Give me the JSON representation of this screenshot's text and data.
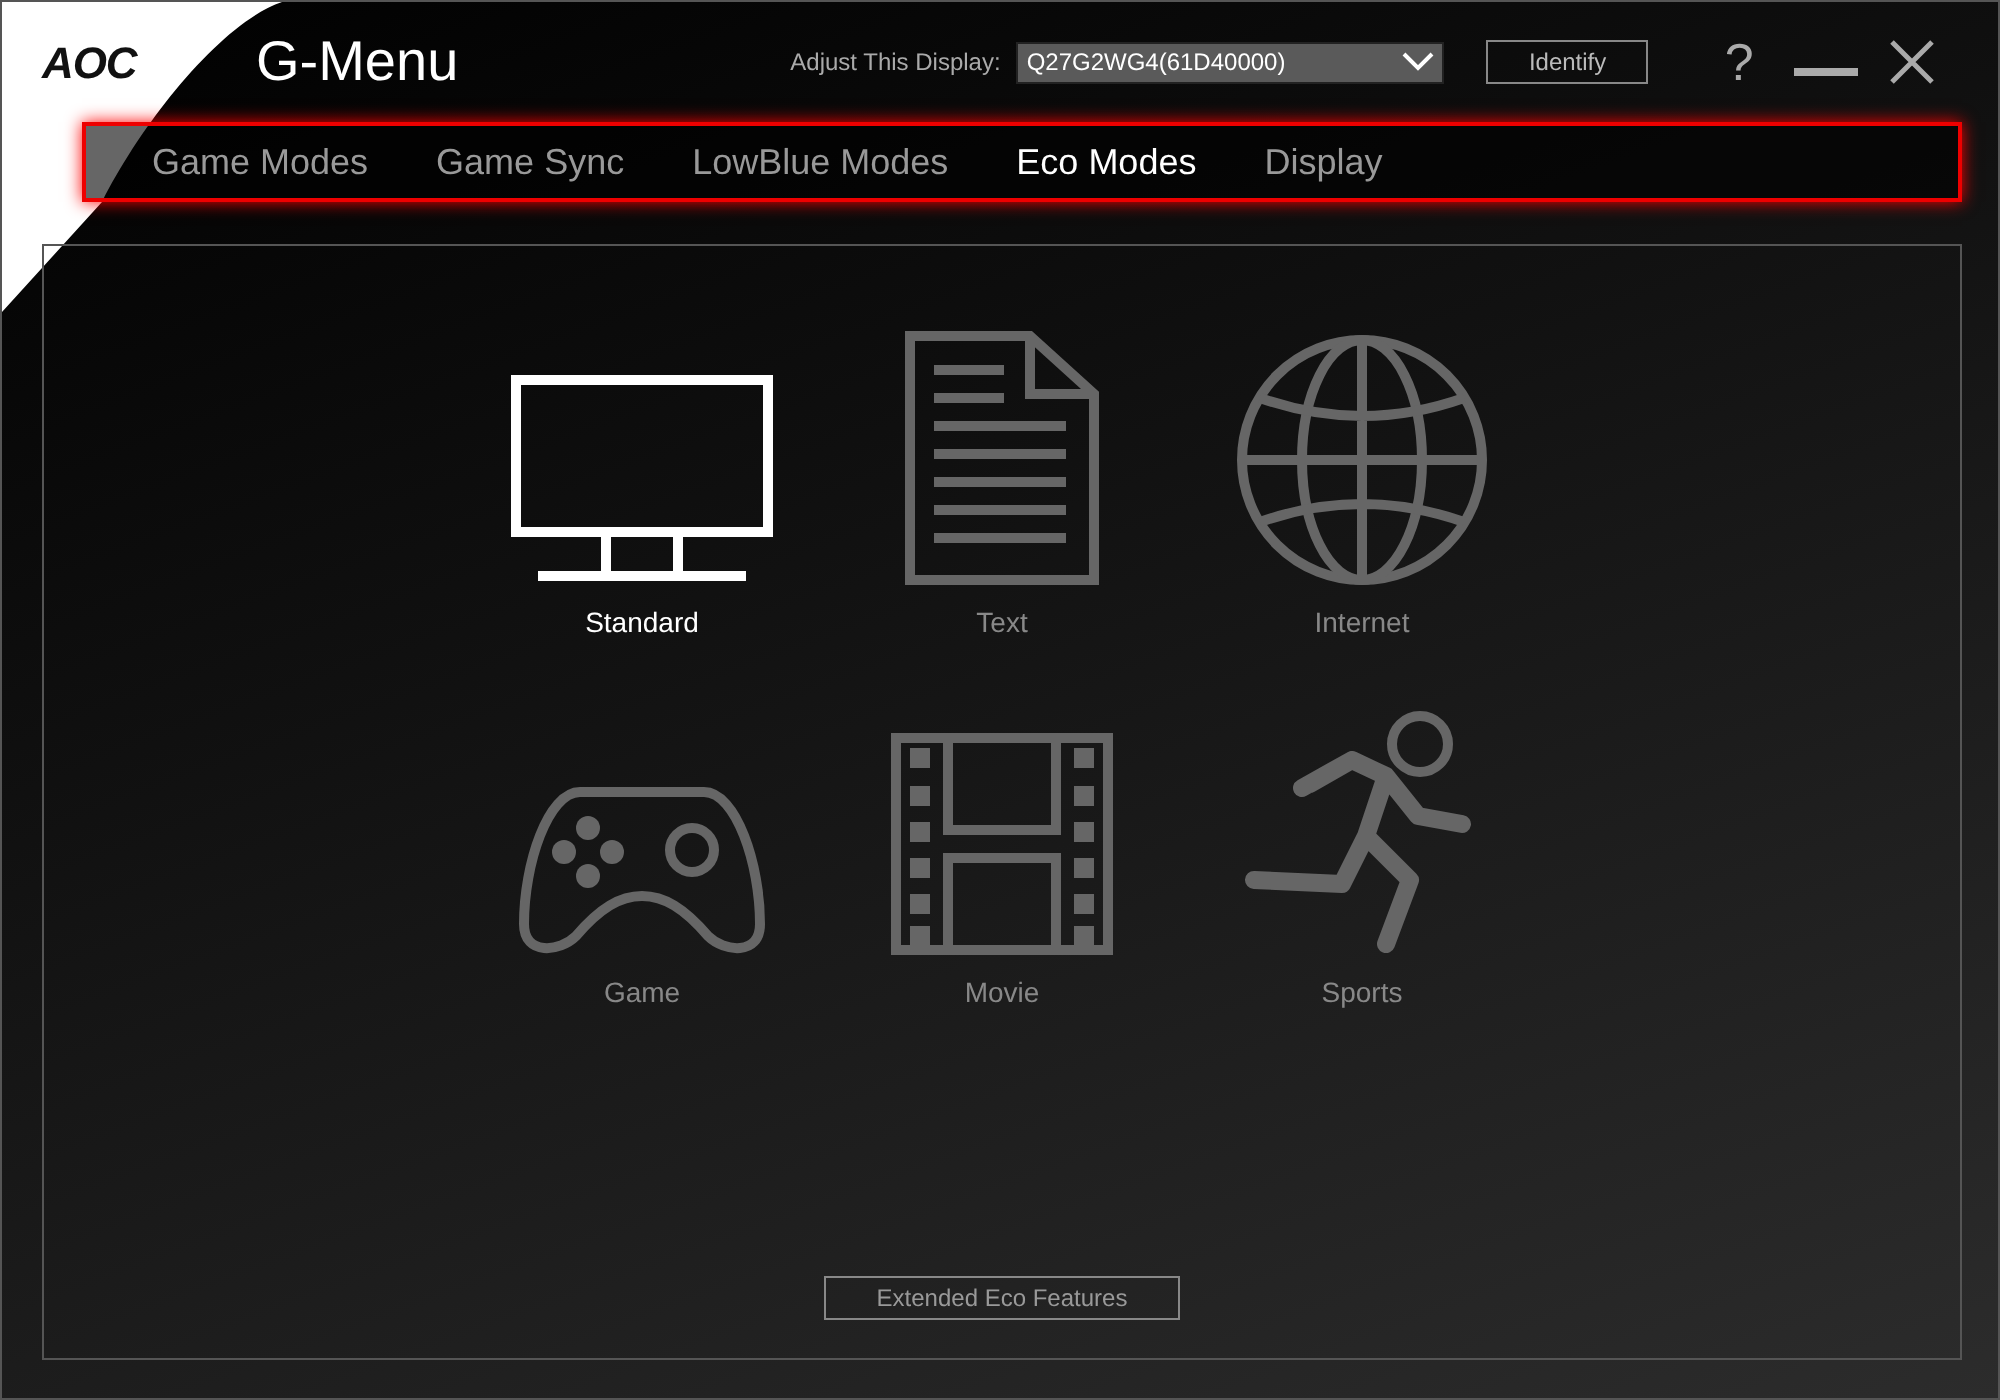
{
  "window": {
    "logo": "AOC",
    "title": "G-Menu"
  },
  "display_selector": {
    "label": "Adjust This Display:",
    "value": "Q27G2WG4(61D40000)"
  },
  "identify_button": "Identify",
  "help_button": "?",
  "tabs": [
    {
      "label": "Game Modes",
      "selected": false
    },
    {
      "label": "Game Sync",
      "selected": false
    },
    {
      "label": "LowBlue Modes",
      "selected": false
    },
    {
      "label": "Eco Modes",
      "selected": true
    },
    {
      "label": "Display",
      "selected": false
    }
  ],
  "modes": [
    {
      "kind": "standard",
      "label": "Standard",
      "selected": true
    },
    {
      "kind": "text",
      "label": "Text",
      "selected": false
    },
    {
      "kind": "internet",
      "label": "Internet",
      "selected": false
    },
    {
      "kind": "game",
      "label": "Game",
      "selected": false
    },
    {
      "kind": "movie",
      "label": "Movie",
      "selected": false
    },
    {
      "kind": "sports",
      "label": "Sports",
      "selected": false
    }
  ],
  "extended_button": "Extended Eco Features"
}
